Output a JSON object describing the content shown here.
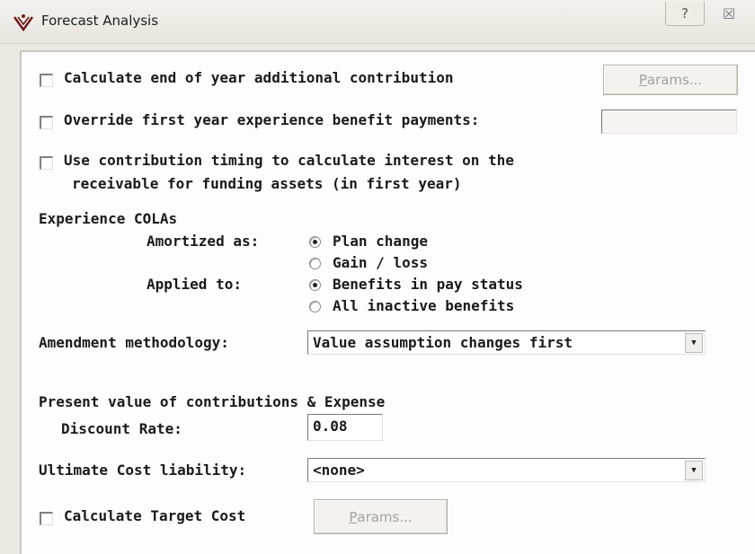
{
  "window": {
    "title": "Forecast Analysis",
    "help_glyph": "?",
    "close_glyph": "☒"
  },
  "options": {
    "calc_eoy": {
      "label": "Calculate end of year additional contribution",
      "checked": false,
      "params_label": "Params...",
      "params_access": "P",
      "params_rest": "arams..."
    },
    "override": {
      "label": "Override first year experience benefit payments:",
      "checked": false,
      "value": ""
    },
    "timing": {
      "label_line1": "Use contribution timing to calculate interest on the",
      "label_line2": "receivable for funding assets (in first year)",
      "checked": false
    }
  },
  "colas": {
    "heading": "Experience COLAs",
    "amortized": {
      "label": "Amortized as:",
      "options": [
        "Plan change",
        "Gain / loss"
      ],
      "selected": "Plan change"
    },
    "applied": {
      "label": "Applied to:",
      "options": [
        "Benefits in pay status",
        "All inactive benefits"
      ],
      "selected": "Benefits in pay status"
    }
  },
  "amendment": {
    "label": "Amendment methodology:",
    "value": "Value assumption changes first"
  },
  "present_value": {
    "heading": "Present value of contributions & Expense",
    "discount_label": "Discount Rate:",
    "discount_value": "0.08"
  },
  "ultimate": {
    "label": "Ultimate Cost liability:",
    "value": "<none>"
  },
  "target": {
    "label": "Calculate Target Cost",
    "checked": false,
    "params_label": "Params...",
    "params_access": "P",
    "params_rest": "arams..."
  }
}
